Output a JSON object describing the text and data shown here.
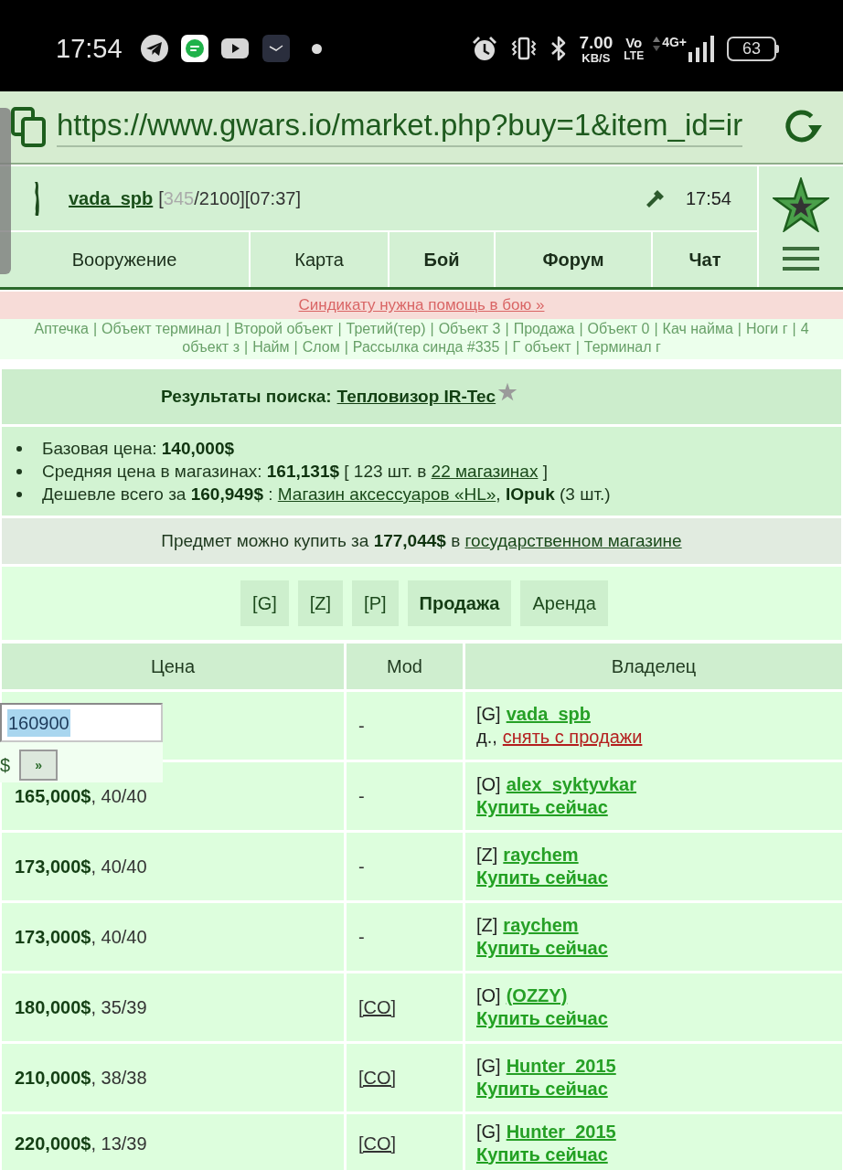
{
  "status_bar": {
    "time": "17:54",
    "speed_value": "7.00",
    "speed_unit": "KB/S",
    "volte": [
      "Vo",
      "LTE"
    ],
    "network": "4G+",
    "battery": "63"
  },
  "browser": {
    "url": "https://www.gwars.io/market.php?buy=1&item_id=ir"
  },
  "header": {
    "username": "vada_spb",
    "stats": [
      {
        "text": "[",
        "dim": false
      },
      {
        "text": "345",
        "dim": true
      },
      {
        "text": "/2100][07:37]",
        "dim": false
      }
    ],
    "time": "17:54"
  },
  "nav": [
    {
      "label": "Вооружение",
      "bold": false
    },
    {
      "label": "Карта",
      "bold": false
    },
    {
      "label": "Бой",
      "bold": true
    },
    {
      "label": "Форум",
      "bold": true
    },
    {
      "label": "Чат",
      "bold": true
    }
  ],
  "alert": "Синдикату нужна помощь в бою »",
  "quick_links": {
    "separator": "|",
    "lines": [
      [
        "Аптечка",
        "Объект терминал",
        "Второй объект",
        "Третий(тер)",
        "Объект 3",
        "Продажа",
        "Объект 0",
        "Кач найма",
        "Ноги г",
        "4"
      ],
      [
        "объект з",
        "Найм",
        "Слом",
        "Рассылка синда #335",
        "Г объект",
        "Терминал г"
      ]
    ]
  },
  "search": {
    "label": "Результаты поиска:",
    "item": "Тепловизор IR-Tec"
  },
  "info": [
    [
      {
        "kind": "text",
        "text": "Базовая цена: **140,000$**"
      }
    ],
    [
      {
        "kind": "text",
        "text": "Средняя цена в магазинах: **161,131$** [ 123 шт. в "
      },
      {
        "kind": "link",
        "text": "22 магазинах"
      },
      {
        "kind": "text",
        "text": " ]"
      }
    ],
    [
      {
        "kind": "text",
        "text": "Дешевле всего за **160,949$** : "
      },
      {
        "kind": "link",
        "text": "Магазин аксессуаров «HL»"
      },
      {
        "kind": "text",
        "text": ", **IOpuk** (3 шт.)"
      }
    ]
  ],
  "gov_shop": [
    {
      "kind": "text",
      "text": "Предмет можно купить за **177,044$** в "
    },
    {
      "kind": "link",
      "text": "государственном магазине"
    }
  ],
  "filters": [
    {
      "label": "[G]",
      "selected": false
    },
    {
      "label": "[Z]",
      "selected": false
    },
    {
      "label": "[P]",
      "selected": false
    },
    {
      "label": "Продажа",
      "selected": true
    },
    {
      "label": "Аренда",
      "selected": false
    }
  ],
  "table": {
    "columns": [
      "Цена",
      "Mod",
      "Владелец"
    ],
    "rows": [
      {
        "kind": "own",
        "price_input": "160900",
        "input_selected": true,
        "currency": "$",
        "submit": "»",
        "mod": "-",
        "mod_link": false,
        "tag": "[G]",
        "owner": "vada_spb",
        "note": "д.,",
        "action": "снять с продажи"
      },
      {
        "kind": "offer",
        "price": "**165,000$**, 40/40",
        "mod": "-",
        "mod_link": false,
        "tag": "[O]",
        "owner": "alex_syktyvkar",
        "action": "Купить сейчас"
      },
      {
        "kind": "offer",
        "price": "**173,000$**, 40/40",
        "mod": "-",
        "mod_link": false,
        "tag": "[Z]",
        "owner": "raychem",
        "action": "Купить сейчас"
      },
      {
        "kind": "offer",
        "price": "**173,000$**, 40/40",
        "mod": "-",
        "mod_link": false,
        "tag": "[Z]",
        "owner": "raychem",
        "action": "Купить сейчас"
      },
      {
        "kind": "offer",
        "price": "**180,000$**, 35/39",
        "mod": "[CO]",
        "mod_link": true,
        "tag": "[O]",
        "owner": "(OZZY)",
        "action": "Купить сейчас"
      },
      {
        "kind": "offer",
        "price": "**210,000$**, 38/38",
        "mod": "[CO]",
        "mod_link": true,
        "tag": "[G]",
        "owner": "Hunter_2015",
        "action": "Купить сейчас"
      },
      {
        "kind": "offer",
        "price": "**220,000$**, 13/39",
        "mod": "[CO]",
        "mod_link": true,
        "tag": "[G]",
        "owner": "Hunter_2015",
        "action": "Купить сейчас"
      }
    ]
  }
}
